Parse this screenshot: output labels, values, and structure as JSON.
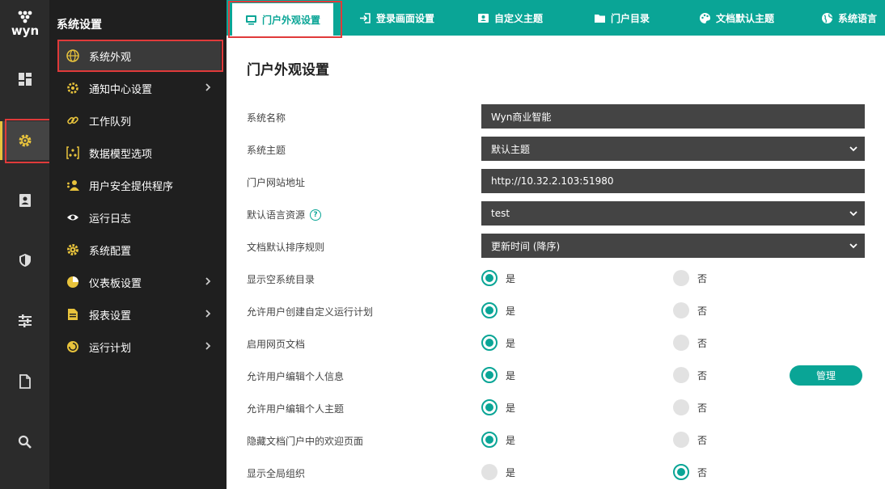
{
  "rail": {
    "logo_text": "wyn",
    "items": [
      {
        "icon": "dashboard-icon"
      },
      {
        "icon": "gear-icon",
        "active": true
      },
      {
        "icon": "contact-card-icon"
      },
      {
        "icon": "shield-icon"
      },
      {
        "icon": "sliders-icon"
      },
      {
        "icon": "document-icon"
      },
      {
        "icon": "search-icon"
      }
    ]
  },
  "sidebar": {
    "title": "系统设置",
    "items": [
      {
        "label": "系统外观",
        "icon": "globe-icon",
        "active": true
      },
      {
        "label": "通知中心设置",
        "icon": "gear-icon",
        "chevron": true
      },
      {
        "label": "工作队列",
        "icon": "link-icon"
      },
      {
        "label": "数据模型选项",
        "icon": "data-model-icon"
      },
      {
        "label": "用户安全提供程序",
        "icon": "user-security-icon"
      },
      {
        "label": "运行日志",
        "icon": "eye-icon"
      },
      {
        "label": "系统配置",
        "icon": "gear-icon"
      },
      {
        "label": "仪表板设置",
        "icon": "pie-chart-icon",
        "chevron": true
      },
      {
        "label": "报表设置",
        "icon": "report-icon",
        "chevron": true
      },
      {
        "label": "运行计划",
        "icon": "clock-icon",
        "chevron": true
      }
    ]
  },
  "tabs": [
    {
      "label": "门户外观设置",
      "icon": "monitor-icon",
      "active": true
    },
    {
      "label": "登录画面设置",
      "icon": "login-icon"
    },
    {
      "label": "自定义主题",
      "icon": "theme-icon"
    },
    {
      "label": "门户目录",
      "icon": "folder-icon"
    },
    {
      "label": "文档默认主题",
      "icon": "palette-icon"
    },
    {
      "label": "系统语言",
      "icon": "globe-icon"
    }
  ],
  "main": {
    "title": "门户外观设置",
    "fields": [
      {
        "label": "系统名称",
        "value": "Wyn商业智能",
        "dropdown": false
      },
      {
        "label": "系统主题",
        "value": "默认主题",
        "dropdown": true
      },
      {
        "label": "门户网站地址",
        "value": "http://10.32.2.103:51980",
        "dropdown": false
      },
      {
        "label": "默认语言资源",
        "value": "test",
        "dropdown": true,
        "help": true
      },
      {
        "label": "文档默认排序规则",
        "value": "更新时间 (降序)",
        "dropdown": true
      }
    ],
    "yes_label": "是",
    "no_label": "否",
    "toggles": [
      {
        "label": "显示空系统目录",
        "value": "是"
      },
      {
        "label": "允许用户创建自定义运行计划",
        "value": "是"
      },
      {
        "label": "启用网页文档",
        "value": "是"
      },
      {
        "label": "允许用户编辑个人信息",
        "value": "是"
      },
      {
        "label": "允许用户编辑个人主题",
        "value": "是"
      },
      {
        "label": "隐藏文档门户中的欢迎页面",
        "value": "是"
      },
      {
        "label": "显示全局组织",
        "value": "否"
      }
    ],
    "manage_label": "管理",
    "help_glyph": "?"
  },
  "colors": {
    "accent": "#0aa596",
    "highlight": "#e03a3a",
    "rail_active": "#e8c33c"
  }
}
